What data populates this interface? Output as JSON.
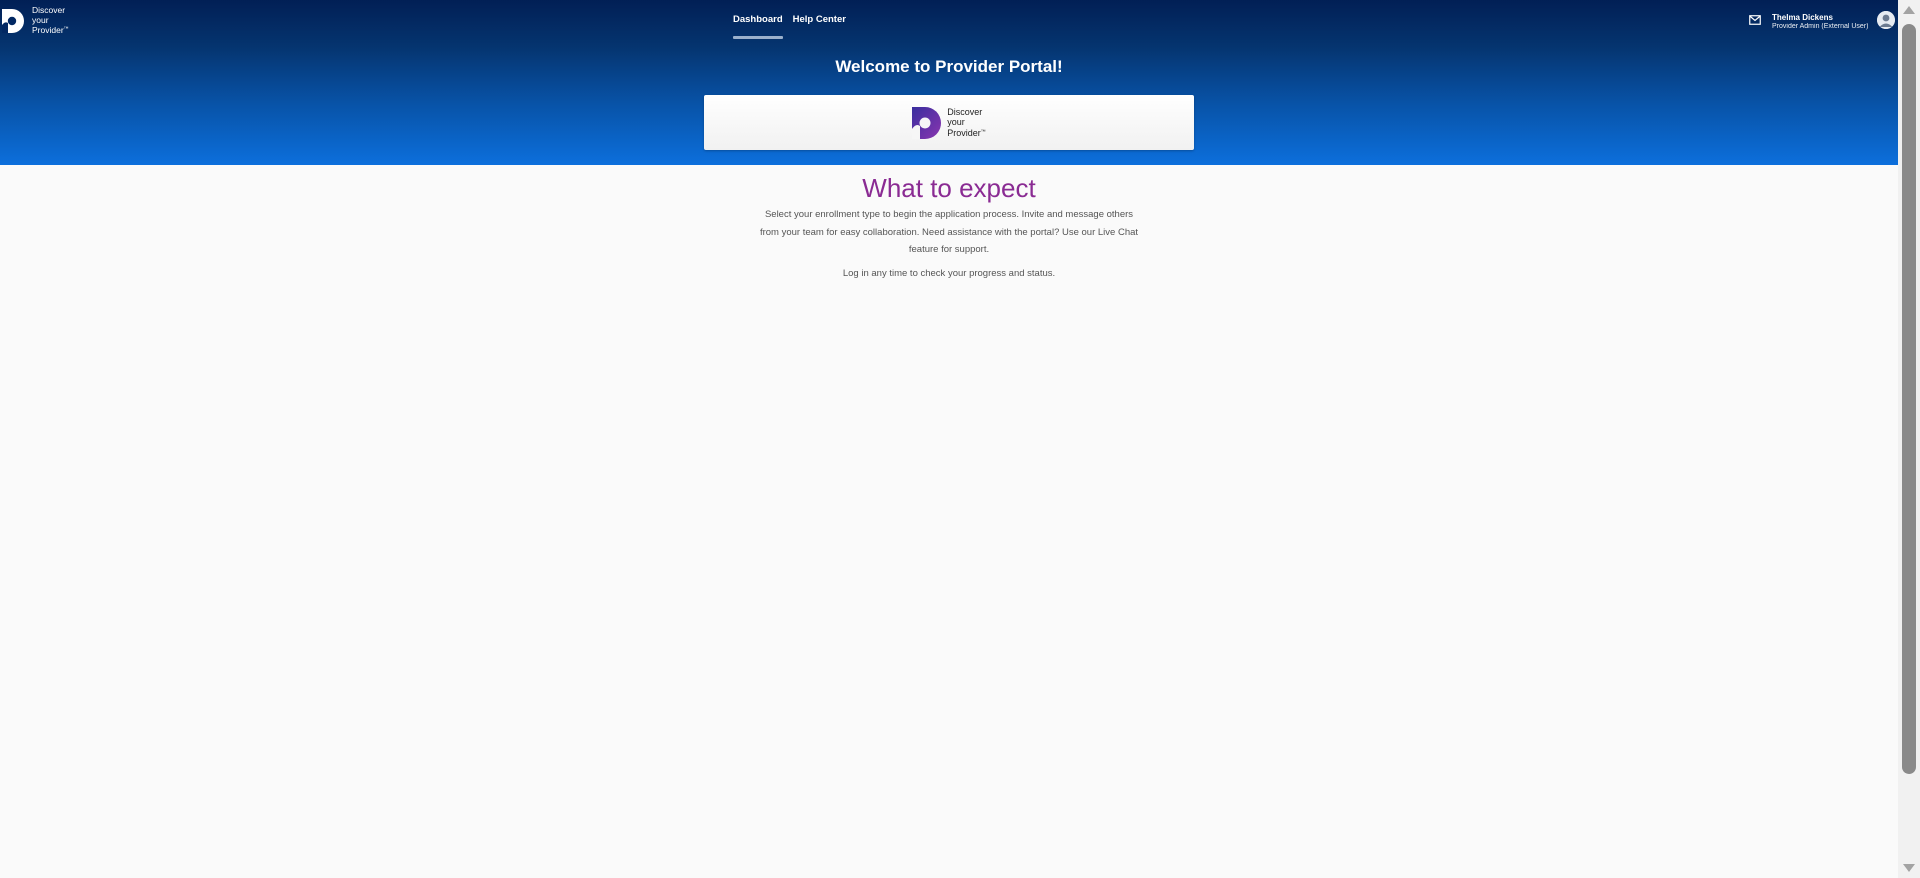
{
  "header": {
    "logo_text": [
      "Discover",
      "your",
      "Provider"
    ],
    "logo_tm": "™",
    "nav": [
      {
        "label": "Dashboard",
        "active": true
      },
      {
        "label": "Help Center",
        "active": false
      }
    ],
    "user": {
      "name": "Thelma Dickens",
      "role": "Provider Admin (External User)"
    }
  },
  "hero": {
    "title": "Welcome to Provider Portal!"
  },
  "main": {
    "heading": "What to expect",
    "description": "Select your enrollment type to begin the application process. Invite and message others from your team for easy collaboration. Need assistance with the portal? Use our Live Chat feature for support.",
    "note": "Log in any time to check your progress and status."
  },
  "colors": {
    "header_dark": "#011f55",
    "header_bright": "#0c6fdc",
    "heading_purple": "#8a2b93",
    "logo_gradient_start": "#3a2f9e",
    "logo_gradient_end": "#8a35b0"
  }
}
